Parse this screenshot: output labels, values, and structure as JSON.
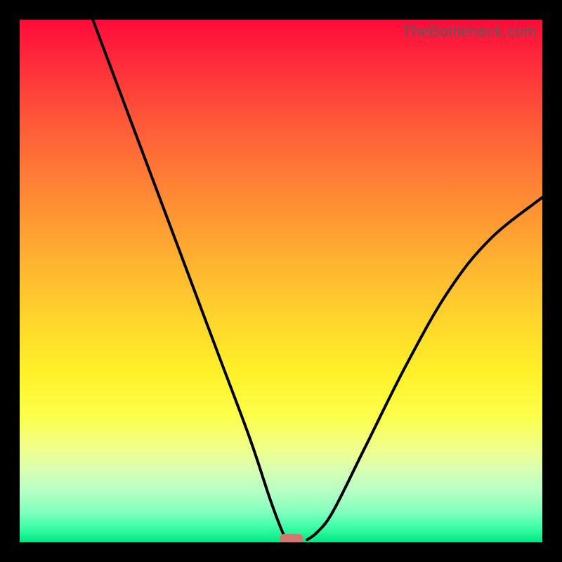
{
  "watermark": "TheBottleneck.com",
  "chart_data": {
    "type": "line",
    "title": "",
    "xlabel": "",
    "ylabel": "",
    "xlim": [
      0,
      100
    ],
    "ylim": [
      0,
      100
    ],
    "grid": false,
    "legend": false,
    "series": [
      {
        "name": "left-branch",
        "x": [
          14,
          20,
          26,
          32,
          38,
          44,
          48,
          50.5,
          51.5
        ],
        "y": [
          100,
          84,
          68,
          52,
          36,
          20,
          8,
          1.5,
          0.5
        ]
      },
      {
        "name": "right-branch",
        "x": [
          55,
          57,
          60,
          66,
          74,
          82,
          90,
          100
        ],
        "y": [
          0.5,
          2,
          6,
          18,
          34,
          48,
          58,
          66
        ]
      }
    ],
    "marker": {
      "x": 52,
      "y": 0.5,
      "color": "#d17870"
    },
    "background_gradient": {
      "top": "#ff0a3a",
      "mid": "#fff22a",
      "bottom": "#00e884"
    }
  },
  "plot_geometry": {
    "inner_w": 744,
    "inner_h": 744
  }
}
